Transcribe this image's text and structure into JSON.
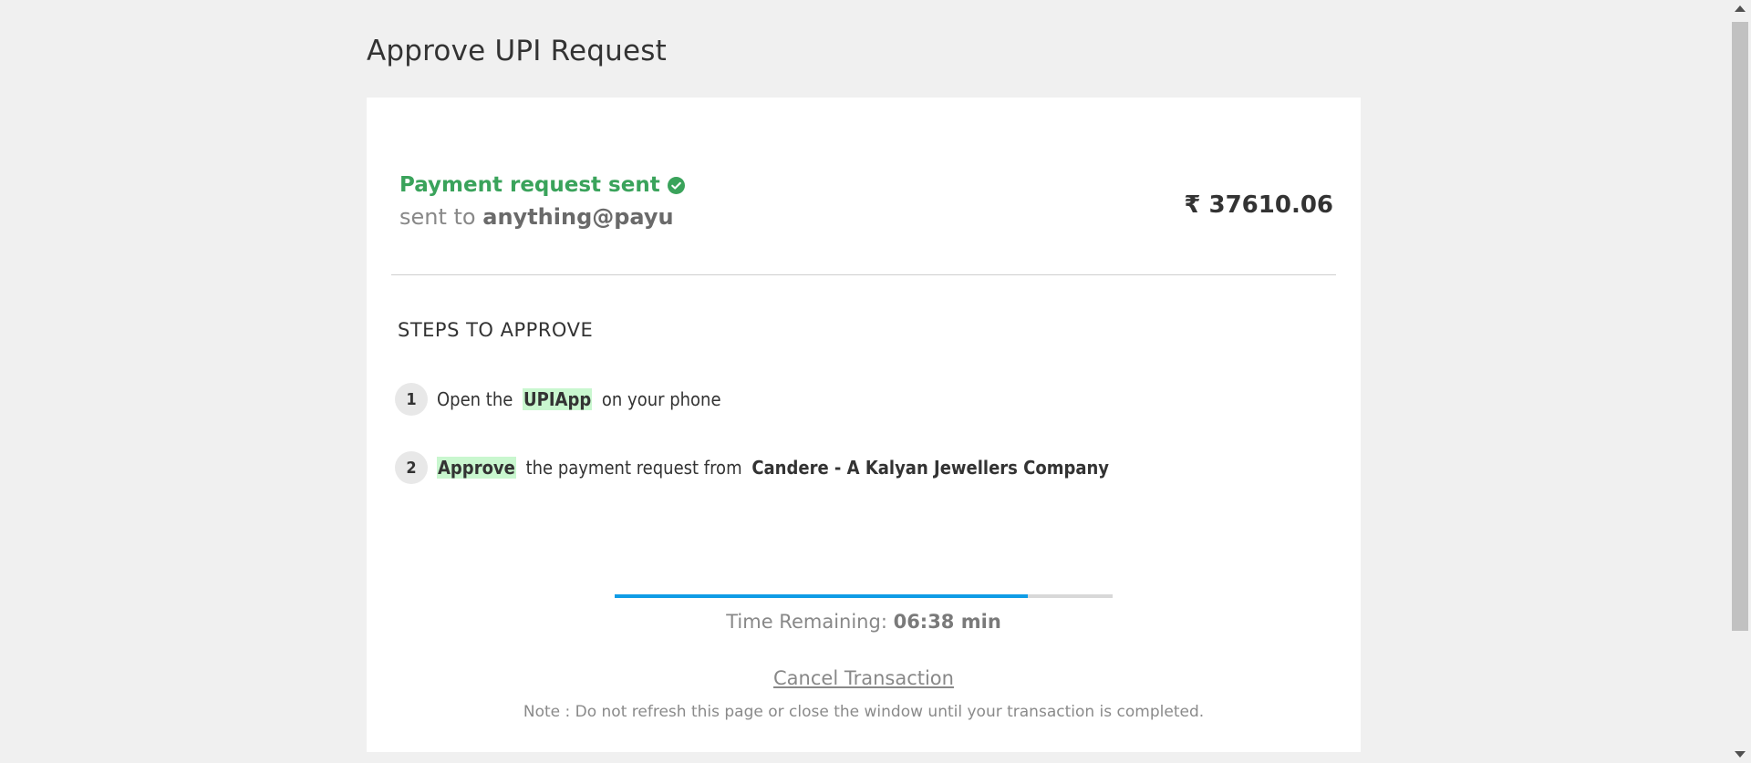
{
  "page": {
    "title": "Approve UPI Request"
  },
  "status": {
    "message": "Payment request sent",
    "sent_to_prefix": "sent to",
    "vpa": "anything@payu",
    "amount": "₹ 37610.06"
  },
  "steps": {
    "heading": "STEPS TO APPROVE",
    "items": [
      {
        "number": "1",
        "text_before": "Open the",
        "highlight": "UPIApp",
        "text_after": "on your phone"
      },
      {
        "number": "2",
        "highlight": "Approve",
        "text_after": "the payment request from",
        "merchant": "Candere - A Kalyan Jewellers Company"
      }
    ]
  },
  "timer": {
    "label": "Time Remaining:",
    "value": "06:38 min",
    "progress_fraction": 0.83
  },
  "actions": {
    "cancel_label": "Cancel Transaction"
  },
  "note": "Note : Do not refresh this page or close the window until your transaction is completed.",
  "colors": {
    "success": "#3aa35b",
    "progress": "#0f9ce6",
    "highlight": "#c9f7cf"
  }
}
